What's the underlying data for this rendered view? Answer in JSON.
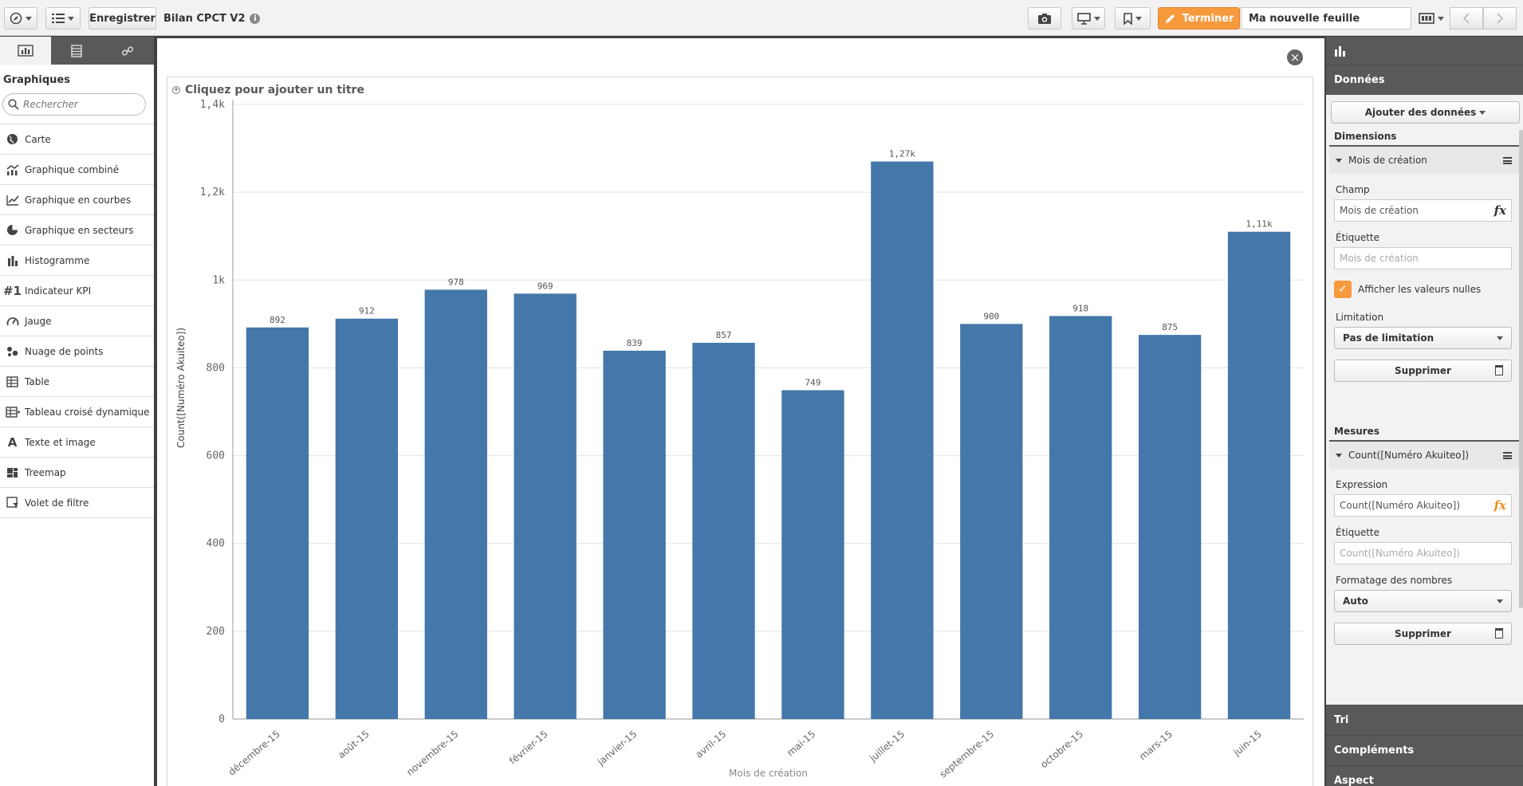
{
  "toolbar": {
    "save_label": "Enregistrer",
    "app_title": "Bilan CPCT V2",
    "done_label": "Terminer",
    "sheet_name": "Ma nouvelle feuille"
  },
  "left_panel": {
    "title": "Graphiques",
    "search_placeholder": "Rechercher",
    "items": [
      {
        "label": "Carte",
        "icon": "globe-icon"
      },
      {
        "label": "Graphique combiné",
        "icon": "combo-chart-icon"
      },
      {
        "label": "Graphique en courbes",
        "icon": "line-chart-icon"
      },
      {
        "label": "Graphique en secteurs",
        "icon": "pie-chart-icon"
      },
      {
        "label": "Histogramme",
        "icon": "bar-chart-icon"
      },
      {
        "label": "Indicateur KPI",
        "icon": "kpi-icon",
        "glyph": "#1"
      },
      {
        "label": "Jauge",
        "icon": "gauge-icon"
      },
      {
        "label": "Nuage de points",
        "icon": "scatter-icon"
      },
      {
        "label": "Table",
        "icon": "table-icon"
      },
      {
        "label": "Tableau croisé dynamique",
        "icon": "pivot-table-icon"
      },
      {
        "label": "Texte et image",
        "icon": "text-icon",
        "glyph": "A"
      },
      {
        "label": "Treemap",
        "icon": "treemap-icon"
      },
      {
        "label": "Volet de filtre",
        "icon": "filter-pane-icon"
      }
    ]
  },
  "chart": {
    "title_placeholder": "Cliquez pour ajouter un titre"
  },
  "chart_data": {
    "type": "bar",
    "categories": [
      "décembre-15",
      "août-15",
      "novembre-15",
      "février-15",
      "janvier-15",
      "avril-15",
      "mai-15",
      "juillet-15",
      "septembre-15",
      "octobre-15",
      "mars-15",
      "juin-15"
    ],
    "values": [
      892,
      912,
      978,
      969,
      839,
      857,
      749,
      1270,
      900,
      918,
      875,
      1110
    ],
    "value_labels": [
      "892",
      "912",
      "978",
      "969",
      "839",
      "857",
      "749",
      "1,27k",
      "900",
      "918",
      "875",
      "1,11k"
    ],
    "yticks": [
      0,
      200,
      400,
      600,
      800,
      1000,
      1200,
      1400
    ],
    "ytick_labels": [
      "0",
      "200",
      "400",
      "600",
      "800",
      "1k",
      "1,2k",
      "1,4k"
    ],
    "ylim": [
      0,
      1400
    ],
    "xlabel": "Mois de création",
    "ylabel": "Count([Numéro Akuiteo])",
    "bar_color": "#4477aa",
    "grid": true
  },
  "right_panel": {
    "section_data": "Données",
    "add_data_label": "Ajouter des données",
    "dimensions_label": "Dimensions",
    "dimension": {
      "title": "Mois de création",
      "field_label": "Champ",
      "field_value": "Mois de création",
      "label_label": "Étiquette",
      "label_placeholder": "Mois de création",
      "show_nulls_label": "Afficher les valeurs nulles",
      "limitation_label": "Limitation",
      "limitation_value": "Pas de limitation",
      "delete_label": "Supprimer"
    },
    "measures_label": "Mesures",
    "measure": {
      "title": "Count([Numéro Akuiteo])",
      "expression_label": "Expression",
      "expression_value": "Count([Numéro Akuiteo])",
      "label_label": "Étiquette",
      "label_placeholder": "Count([Numéro Akuiteo])",
      "format_label": "Formatage des nombres",
      "format_value": "Auto",
      "delete_label": "Supprimer"
    },
    "section_sort": "Tri",
    "section_addons": "Compléments",
    "section_appearance": "Aspect"
  },
  "colors": {
    "accent": "#f79a3e",
    "bar": "#4477aa",
    "panel_dark": "#595959"
  }
}
